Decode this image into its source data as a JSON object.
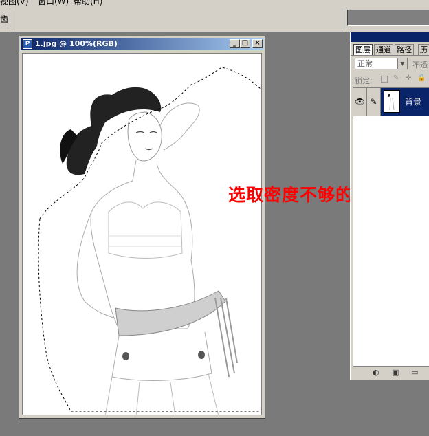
{
  "menu": {
    "items": [
      "视图(V)",
      "窗口(W)",
      "帮助(H)"
    ]
  },
  "options_bar": {
    "tool_label": "齿"
  },
  "document": {
    "title": "1.jpg @ 100%(RGB)",
    "app_icon": "photoshop-doc-icon",
    "controls": {
      "minimize": "_",
      "maximize": "□",
      "close": "×"
    }
  },
  "annotation": {
    "text": "选取密度不够的地方",
    "color": "#ff0000"
  },
  "layers_palette": {
    "tabs": [
      "图层",
      "通道",
      "路径",
      "历"
    ],
    "active_tab": "图层",
    "blend_mode": "正常",
    "opacity_label": "不透",
    "lock_label": "锁定:",
    "layers": [
      {
        "name": "背景",
        "visible": true,
        "selected": true
      }
    ],
    "footer_icons": [
      "new-fill-layer-icon",
      "add-mask-icon",
      "new-group-icon"
    ]
  },
  "colors": {
    "accent": "#0a246a",
    "workspace": "#7a7a7a",
    "chrome": "#d4d0c8"
  }
}
